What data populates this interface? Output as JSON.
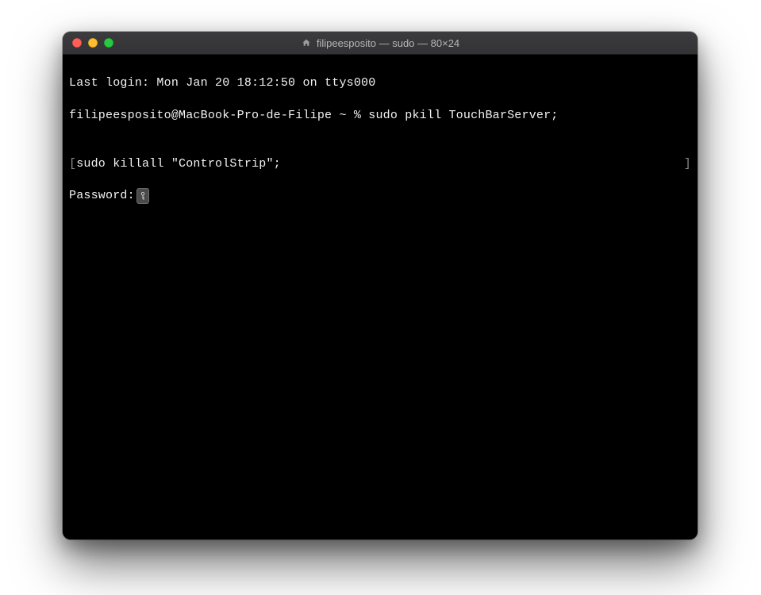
{
  "window": {
    "title": "filipeesposito — sudo — 80×24"
  },
  "terminal": {
    "last_login": "Last login: Mon Jan 20 18:12:50 on ttys000",
    "prompt_line": "filipeesposito@MacBook-Pro-de-Filipe ~ % sudo pkill TouchBarServer;",
    "blank": "",
    "cont_open": "[",
    "cont_cmd": "sudo killall \"ControlStrip\";",
    "cont_close": "]",
    "password_label": "Password:"
  }
}
